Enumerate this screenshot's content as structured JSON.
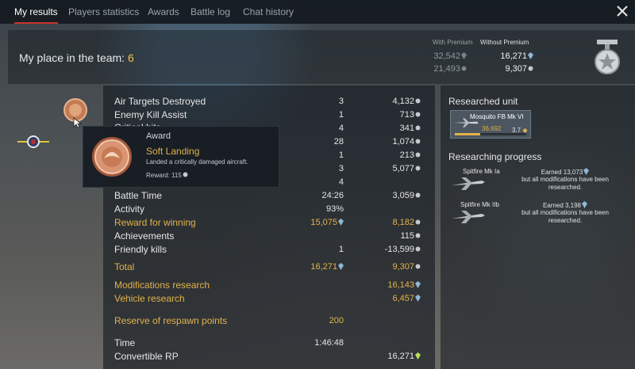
{
  "tabs": [
    {
      "label": "My results",
      "active": true
    },
    {
      "label": "Players statistics",
      "active": false
    },
    {
      "label": "Awards",
      "active": false
    },
    {
      "label": "Battle log",
      "active": false
    },
    {
      "label": "Chat history",
      "active": false
    }
  ],
  "header": {
    "place_label": "My place in the team:",
    "place_value": "6",
    "with_premium_label": "With Premium",
    "without_premium_label": "Without Premium",
    "with_premium_sl": "32,542",
    "with_premium_rp": "21,493",
    "without_premium_sl": "16,271",
    "without_premium_rp": "9,307"
  },
  "rows": [
    {
      "label": "Air Targets Destroyed",
      "count": "3",
      "value": "4,132",
      "icon": "rp-icon"
    },
    {
      "label": "Enemy Kill Assist",
      "count": "1",
      "value": "713",
      "icon": "rp-icon"
    },
    {
      "label": "Critical hits",
      "count": "4",
      "value": "341",
      "icon": "rp-icon"
    },
    {
      "label": "",
      "count": "28",
      "value": "1,074",
      "icon": "rp-icon"
    },
    {
      "label": "",
      "count": "1",
      "value": "213",
      "icon": "rp-icon"
    },
    {
      "label": "",
      "count": "3",
      "value": "5,077",
      "icon": "rp-icon"
    },
    {
      "label": "",
      "count": "4",
      "value": "",
      "icon": ""
    },
    {
      "label": "Battle Time",
      "count": "24:26",
      "value": "3,059",
      "icon": "rp-icon"
    },
    {
      "label": "Activity",
      "count": "93%",
      "value": "",
      "icon": ""
    },
    {
      "label": "Reward for winning",
      "count": "15,075",
      "value": "8,182",
      "icon": "rp-icon",
      "gold": true
    },
    {
      "label": "Achievements",
      "count": "",
      "value": "115",
      "icon": "rp-icon"
    },
    {
      "label": "Friendly kills",
      "count": "1",
      "value": "-13,599",
      "icon": "rp-icon"
    }
  ],
  "totals": {
    "total_label": "Total",
    "total_count": "16,271",
    "total_value": "9,307",
    "mod_research_label": "Modifications research",
    "mod_research_value": "16,143",
    "vehicle_research_label": "Vehicle research",
    "vehicle_research_value": "6,457",
    "reserve_label": "Reserve of respawn points",
    "reserve_value": "200",
    "time_label": "Time",
    "time_value": "1:46:48",
    "convertible_label": "Convertible RP",
    "convertible_value": "16,271"
  },
  "tooltip": {
    "title": "Award",
    "name": "Soft Landing",
    "description": "Landed a critically damaged aircraft.",
    "reward": "Reward: 115"
  },
  "researched_unit": {
    "title": "Researched unit",
    "name": "Mosquito FB Mk VI",
    "rp": "36,692",
    "br": "3.7",
    "progress": 0.35
  },
  "researching": {
    "title": "Researching progress",
    "items": [
      {
        "name": "Spitfire Mk Ia",
        "earned": "Earned 13,073",
        "note": "but all modifications have been researched."
      },
      {
        "name": "Spitfire Mk IIb",
        "earned": "Earned 3,198",
        "note": "but all modifications have been researched."
      }
    ]
  },
  "colors": {
    "accent": "#c8342c",
    "gold": "#e3b24a",
    "rp_blue": "#8fb8d8",
    "gsl_green": "#b6e05a"
  }
}
